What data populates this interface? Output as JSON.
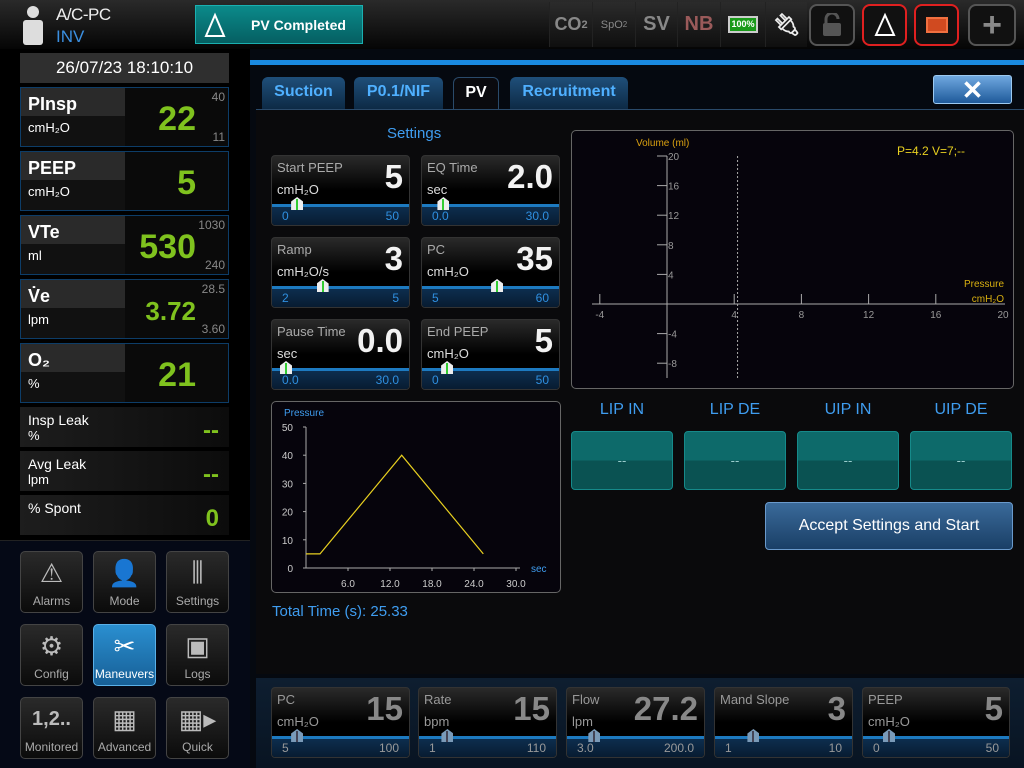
{
  "header": {
    "mode": "A/C-PC",
    "patient_type": "INV",
    "banner": "PV Completed",
    "status_icons": [
      {
        "name": "co2",
        "label": "CO",
        "sub": "2"
      },
      {
        "name": "spo2",
        "label": "SpO",
        "sub": "2"
      },
      {
        "name": "sv",
        "label": "SV"
      },
      {
        "name": "nb",
        "label": "NB"
      },
      {
        "name": "battery",
        "label": "100%"
      }
    ],
    "battery_level": 100
  },
  "datetime": "26/07/23 18:10:10",
  "metrics": [
    {
      "name": "PInsp",
      "unit": "cmH₂O",
      "value": "22",
      "high": "40",
      "low": "11"
    },
    {
      "name": "PEEP",
      "unit": "cmH₂O",
      "value": "5",
      "high": "",
      "low": ""
    },
    {
      "name": "VTe",
      "unit": "ml",
      "value": "530",
      "high": "1030",
      "low": "240"
    },
    {
      "name": "V̇e",
      "unit": "lpm",
      "value": "3.72",
      "high": "28.5",
      "low": "3.60"
    },
    {
      "name": "O₂",
      "unit": "%",
      "value": "21",
      "high": "",
      "low": ""
    }
  ],
  "small_metrics": [
    {
      "name": "Insp Leak",
      "unit": "%",
      "value": "--"
    },
    {
      "name": "Avg Leak",
      "unit": "lpm",
      "value": "--"
    },
    {
      "name": "% Spont",
      "unit": "",
      "value": "0"
    }
  ],
  "nav": [
    {
      "label": "Alarms",
      "icon": "⚠"
    },
    {
      "label": "Mode",
      "icon": "👤"
    },
    {
      "label": "Settings",
      "icon": "⫼"
    },
    {
      "label": "Config",
      "icon": "⚙"
    },
    {
      "label": "Maneuvers",
      "icon": "✂",
      "active": true
    },
    {
      "label": "Logs",
      "icon": "▣"
    },
    {
      "label": "Monitored",
      "icon": "1,2.."
    },
    {
      "label": "Advanced",
      "icon": "▦"
    },
    {
      "label": "Quick",
      "icon": "▦▸"
    }
  ],
  "tabs": [
    {
      "label": "Suction"
    },
    {
      "label": "P0.1/NIF"
    },
    {
      "label": "PV",
      "active": true
    },
    {
      "label": "Recruitment"
    }
  ],
  "close_label": "✕",
  "settings_title": "Settings",
  "settings": [
    {
      "name": "Start PEEP",
      "unit": "cmH₂O",
      "value": "5",
      "min": "0",
      "max": "50",
      "fraction": 0.1
    },
    {
      "name": "EQ Time",
      "unit": "sec",
      "value": "2.0",
      "min": "0.0",
      "max": "30.0",
      "fraction": 0.067
    },
    {
      "name": "Ramp",
      "unit": "cmH₂O/s",
      "value": "3",
      "min": "2",
      "max": "5",
      "fraction": 0.33
    },
    {
      "name": "PC",
      "unit": "cmH₂O",
      "value": "35",
      "min": "5",
      "max": "60",
      "fraction": 0.55
    },
    {
      "name": "Pause Time",
      "unit": "sec",
      "value": "0.0",
      "min": "0.0",
      "max": "30.0",
      "fraction": 0.0
    },
    {
      "name": "End PEEP",
      "unit": "cmH₂O",
      "value": "5",
      "min": "0",
      "max": "50",
      "fraction": 0.1
    }
  ],
  "total_time": "Total Time (s): 25.33",
  "chart_data": [
    {
      "type": "line",
      "title": "Pressure",
      "xlabel": "sec",
      "xlim": [
        0,
        30
      ],
      "ylim": [
        0,
        50
      ],
      "xticks": [
        "6.0",
        "12.0",
        "18.0",
        "24.0",
        "30.0"
      ],
      "yticks": [
        "0",
        "10",
        "20",
        "30",
        "40",
        "50"
      ],
      "x": [
        0,
        2,
        13.67,
        25.33
      ],
      "y": [
        5,
        5,
        40,
        5
      ],
      "color": "#e8d020"
    },
    {
      "type": "scatter",
      "ylabel": "Volume (ml)",
      "xlabel": "Pressure",
      "xunit": "cmH₂O",
      "xlim": [
        -5,
        21
      ],
      "ylim": [
        -10,
        20
      ],
      "xticks": [
        "-4",
        "4",
        "8",
        "12",
        "16",
        "20"
      ],
      "yticks": [
        "20",
        "16",
        "12",
        "8",
        "4",
        "-4",
        "-8"
      ],
      "cursor_x": 4.2,
      "readout": "P=4.2 V=7;--",
      "x": [],
      "y": []
    }
  ],
  "pv_results": [
    {
      "label": "LIP IN",
      "value": "--"
    },
    {
      "label": "LIP DE",
      "value": "--"
    },
    {
      "label": "UIP IN",
      "value": "--"
    },
    {
      "label": "UIP DE",
      "value": "--"
    }
  ],
  "accept_label": "Accept Settings and Start",
  "bottom_settings": [
    {
      "name": "PC",
      "unit": "cmH₂O",
      "value": "15",
      "min": "5",
      "max": "100",
      "fraction": 0.1
    },
    {
      "name": "Rate",
      "unit": "bpm",
      "value": "15",
      "min": "1",
      "max": "110",
      "fraction": 0.13
    },
    {
      "name": "Flow",
      "unit": "lpm",
      "value": "27.2",
      "min": "3.0",
      "max": "200.0",
      "fraction": 0.12
    },
    {
      "name": "Mand Slope",
      "unit": "",
      "value": "3",
      "min": "1",
      "max": "10",
      "fraction": 0.22
    },
    {
      "name": "PEEP",
      "unit": "cmH₂O",
      "value": "5",
      "min": "0",
      "max": "50",
      "fraction": 0.1
    }
  ]
}
